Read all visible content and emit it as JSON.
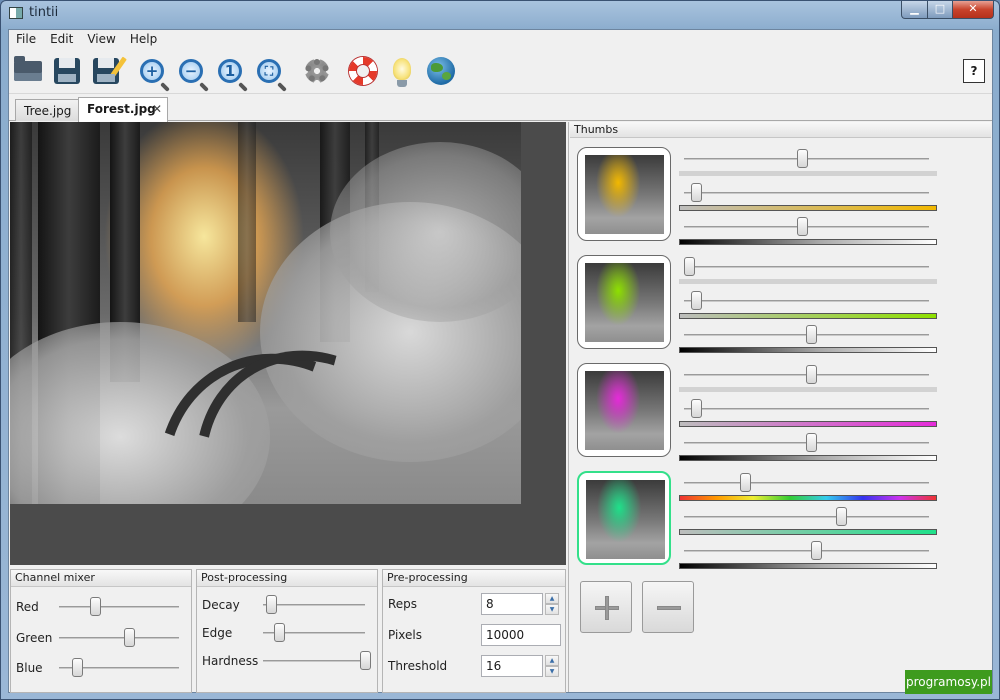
{
  "window": {
    "title": "tintii",
    "icon": "app-icon",
    "controls": {
      "minimize": "▁",
      "maximize": "□",
      "close": "✕"
    }
  },
  "menu": [
    "File",
    "Edit",
    "View",
    "Help"
  ],
  "toolbar": {
    "buttons": [
      {
        "name": "open",
        "icon": "folder-open-icon"
      },
      {
        "name": "save",
        "icon": "floppy-disk-icon"
      },
      {
        "name": "save-as",
        "icon": "floppy-disk-pencil-icon"
      },
      {
        "name": "zoom-in",
        "icon": "zoom-in-icon",
        "glyph": "+"
      },
      {
        "name": "zoom-out",
        "icon": "zoom-out-icon",
        "glyph": "−"
      },
      {
        "name": "zoom-actual",
        "icon": "zoom-actual-size-icon",
        "glyph": "1"
      },
      {
        "name": "zoom-fit",
        "icon": "zoom-fit-icon",
        "glyph": "⛶"
      },
      {
        "name": "settings",
        "icon": "gear-icon"
      },
      {
        "name": "help-manual",
        "icon": "lifebuoy-icon"
      },
      {
        "name": "tips",
        "icon": "lightbulb-icon"
      },
      {
        "name": "website",
        "icon": "globe-icon"
      }
    ],
    "context_help": "?"
  },
  "tabs": [
    {
      "label": "Tree.jpg",
      "active": false
    },
    {
      "label": "Forest.jpg",
      "active": true,
      "close": "✕"
    }
  ],
  "panels": {
    "channel_mixer": {
      "title": "Channel mixer",
      "sliders": [
        {
          "label": "Red",
          "value": 0.3
        },
        {
          "label": "Green",
          "value": 0.58
        },
        {
          "label": "Blue",
          "value": 0.15
        }
      ]
    },
    "post_processing": {
      "title": "Post-processing",
      "sliders": [
        {
          "label": "Decay",
          "value": 0.08
        },
        {
          "label": "Edge",
          "value": 0.16
        },
        {
          "label": "Hardness",
          "value": 1.0
        }
      ]
    },
    "pre_processing": {
      "title": "Pre-processing",
      "fields": [
        {
          "label": "Reps",
          "value": "8",
          "spinner": true
        },
        {
          "label": "Pixels",
          "value": "10000",
          "spinner": false
        },
        {
          "label": "Threshold",
          "value": "16",
          "spinner": true
        }
      ]
    }
  },
  "thumbs": {
    "title": "Thumbs",
    "items": [
      {
        "tint_color": "#f2b800",
        "selected": false,
        "hue": 0.48,
        "saturation": 0.05,
        "brightness": 0.48,
        "hue_bar": "flat",
        "sat_bar_color": "#f2b800"
      },
      {
        "tint_color": "#8ee000",
        "selected": false,
        "hue": 0.02,
        "saturation": 0.05,
        "brightness": 0.52,
        "hue_bar": "flat",
        "sat_bar_color": "#8ee000"
      },
      {
        "tint_color": "#e52bd9",
        "selected": false,
        "hue": 0.52,
        "saturation": 0.05,
        "brightness": 0.52,
        "hue_bar": "flat",
        "sat_bar_color": "#e52bd9"
      },
      {
        "tint_color": "#1fe08a",
        "selected": true,
        "hue": 0.25,
        "saturation": 0.64,
        "brightness": 0.54,
        "hue_bar": "rainbow",
        "sat_bar_color": "#1fe08a"
      }
    ],
    "add_icon": "plus-icon",
    "remove_icon": "minus-icon"
  },
  "watermark": "programosy.pl"
}
